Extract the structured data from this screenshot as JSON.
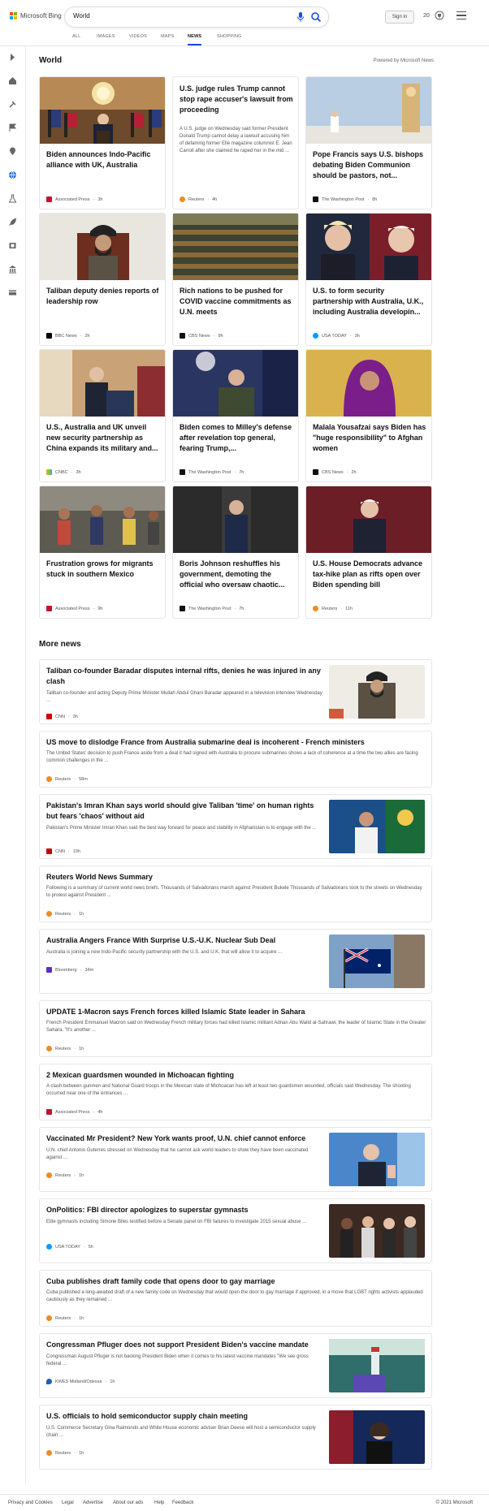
{
  "brand": {
    "name": "Microsoft Bing",
    "colors": [
      "#f25022",
      "#7fba00",
      "#00a4ef",
      "#ffb900"
    ]
  },
  "search": {
    "query": "World"
  },
  "header": {
    "signin_label": "Sign in",
    "rewards_count": "20"
  },
  "nav": {
    "items": [
      "ALL",
      "IMAGES",
      "VIDEOS",
      "MAPS",
      "NEWS",
      "SHOPPING"
    ],
    "active": "NEWS",
    "accent": "#174ae4"
  },
  "rail": {
    "icons": [
      "expand-icon",
      "home-icon",
      "tools-icon",
      "flag-icon",
      "pin-icon",
      "globe-icon",
      "science-icon",
      "rocket-icon",
      "film-icon",
      "bank-icon",
      "card-icon"
    ]
  },
  "section": {
    "title": "World",
    "powered_by": "Powered by Microsoft News"
  },
  "cards": [
    {
      "title": "Biden announces Indo-Pacific alliance with UK, Australia",
      "source": "Associated Press",
      "age": "3h",
      "image": "press-room-icon"
    },
    {
      "title": "U.S. judge rules Trump cannot stop rape accuser's lawsuit from proceeding",
      "snippet": "A U.S. judge on Wednesday said former President Donald Trump cannot delay a lawsuit accusing him of defaming former Elle magazine columnist E. Jean Carroll after she claimed he raped her in the mid ...",
      "source": "Reuters",
      "age": "4h"
    },
    {
      "title": "Pope Francis says U.S. bishops debating Biden Communion should be pastors, not...",
      "source": "The Washington Post",
      "age": "8h"
    },
    {
      "title": "Taliban deputy denies reports of leadership row",
      "source": "BBC News",
      "age": "2h"
    },
    {
      "title": "Rich nations to be pushed for COVID vaccine commitments as U.N. meets",
      "source": "CBS News",
      "age": "9h"
    },
    {
      "title": "U.S. to form security partnership with Australia, U.K., including Australia developin...",
      "source": "USA TODAY",
      "age": "3h"
    },
    {
      "title": "U.S., Australia and UK unveil new security partnership as China expands its military and...",
      "source": "CNBC",
      "age": "3h"
    },
    {
      "title": "Biden comes to Milley's defense after revelation top general, fearing Trump,...",
      "source": "The Washington Post",
      "age": "7h"
    },
    {
      "title": "Malala Yousafzai says Biden has \"huge responsibility\" to Afghan women",
      "source": "CBS News",
      "age": "2h"
    },
    {
      "title": "Frustration grows for migrants stuck in southern Mexico",
      "source": "Associated Press",
      "age": "9h"
    },
    {
      "title": "Boris Johnson reshuffles his government, demoting the official who oversaw chaotic...",
      "source": "The Washington Post",
      "age": "7h"
    },
    {
      "title": "U.S. House Democrats advance tax-hike plan as rifts open over Biden spending bill",
      "source": "Reuters",
      "age": "11h"
    }
  ],
  "more_news": {
    "title": "More news",
    "items": [
      {
        "title": "Taliban co-founder Baradar disputes internal rifts, denies he was injured in any clash",
        "snippet": "Taliban co-founder and acting Deputy Prime Minister Mullah Abdul Ghani Baradar appeared in a television interview Wednesday ...",
        "source": "CNN",
        "age": "3h"
      },
      {
        "title": "US move to dislodge France from Australia submarine deal is incoherent - French ministers",
        "snippet": "The United States' decision to push France aside from a deal it had signed with Australia to procure submarines shows a lack of coherence at a time the two allies are facing common challenges in the ...",
        "source": "Reuters",
        "age": "58m"
      },
      {
        "title": "Pakistan's Imran Khan says world should give Taliban 'time' on human rights but fears 'chaos' without aid",
        "snippet": "Pakistan's Prime Minister Imran Khan said the best way forward for peace and stability in Afghanistan is to engage with the ...",
        "source": "CNN",
        "age": "10h"
      },
      {
        "title": "Reuters World News Summary",
        "snippet": "Following is a summary of current world news briefs. Thousands of Salvadorans march against President Bukele Thousands of Salvadorans took to the streets on Wednesday to protest against President ...",
        "source": "Reuters",
        "age": "1h"
      },
      {
        "title": "Australia Angers France With Surprise U.S.-U.K. Nuclear Sub Deal",
        "snippet": "Australia is joining a new Indo-Pacific security partnership with the U.S. and U.K. that will allow it to acquire ...",
        "source": "Bloomberg",
        "age": "34m"
      },
      {
        "title": "UPDATE 1-Macron says French forces killed Islamic State leader in Sahara",
        "snippet": "French President Emmanuel Macron said on Wednesday French military forces had killed Islamic militant Adnan Abu Walid al-Sahrawi, the leader of Islamic State in the Greater Sahara. \"It's another ...",
        "source": "Reuters",
        "age": "1h"
      },
      {
        "title": "2 Mexican guardsmen wounded in Michoacan fighting",
        "snippet": "A clash between gunmen and National Guard troops in the Mexican state of Michoacan has left at least two guardsmen wounded, officials said Wednesday. The shooting occurred near one of the entrances ...",
        "source": "Associated Press",
        "age": "4h"
      },
      {
        "title": "Vaccinated Mr President? New York wants proof, U.N. chief cannot enforce",
        "snippet": "U.N. chief Antonio Guterres stressed on Wednesday that he cannot ask world leaders to show they have been vaccinated against ...",
        "source": "Reuters",
        "age": "1h"
      },
      {
        "title": "OnPolitics: FBI director apologizes to superstar gymnasts",
        "snippet": "Elite gymnasts including Simone Biles testified before a Senate panel on FBI failures to investigate 2015 sexual abuse ...",
        "source": "USA TODAY",
        "age": "5h"
      },
      {
        "title": "Cuba publishes draft family code that opens door to gay marriage",
        "snippet": "Cuba published a long-awaited draft of a new family code on Wednesday that would open the door to gay marriage if approved, in a move that LGBT rights activists applauded cautiously as they remained ...",
        "source": "Reuters",
        "age": "1h"
      },
      {
        "title": "Congressman Pfluger does not support President Biden's vaccine mandate",
        "snippet": "Congressman August Pfluger is not backing President Biden when it comes to his latest vaccine mandates \"We see gross federal ...",
        "source": "KWES Midland/Odessa",
        "age": "1h"
      },
      {
        "title": "U.S. officials to hold semiconductor supply chain meeting",
        "snippet": "U.S. Commerce Secretary Gina Raimondo and White House economic adviser Brian Deese will host a semiconductor supply chain ...",
        "source": "Reuters",
        "age": "1h"
      }
    ]
  },
  "footer": {
    "links": [
      "Privacy and Cookies",
      "Legal",
      "Advertise",
      "About our ads",
      "Help",
      "Feedback"
    ],
    "copyright": "© 2021 Microsoft"
  }
}
